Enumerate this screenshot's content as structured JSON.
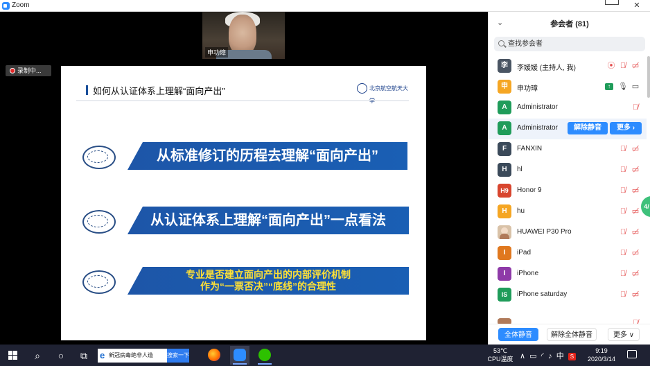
{
  "window": {
    "title": "Zoom"
  },
  "video": {
    "speaker_name": "申功璋",
    "recording_label": "录制中..."
  },
  "slide": {
    "title": "如何从认证体系上理解“面向产出”",
    "university": "北京航空航天大学",
    "bands": [
      {
        "text": "从标准修订的历程去理解“面向产出”"
      },
      {
        "text": "从认证体系上理解“面向产出”一点看法"
      },
      {
        "line1": "专业是否建立面向产出的内部评价机制",
        "line2": "作为“一票否决”“底线”的合理性"
      }
    ]
  },
  "participants_panel": {
    "title": "参会者 (81)",
    "search_placeholder": "查找参会者",
    "participants": [
      {
        "avatar": "李",
        "color": "#4a5563",
        "name": "李媛媛 (主持人, 我)"
      },
      {
        "avatar": "申",
        "color": "#f5a623",
        "name": "申功璋"
      },
      {
        "avatar": "A",
        "color": "#1f9c5a",
        "name": "Administrator"
      },
      {
        "avatar": "A",
        "color": "#1f9c5a",
        "name": "Administrator",
        "unmute_label": "解除静音",
        "more_label": "更多 ›"
      },
      {
        "avatar": "F",
        "color": "#3b4a5a",
        "name": "FANXIN"
      },
      {
        "avatar": "H",
        "color": "#3b4a5a",
        "name": "hl"
      },
      {
        "avatar": "H9",
        "color": "#d8452e",
        "name": "Honor 9"
      },
      {
        "avatar": "H",
        "color": "#f5a623",
        "name": "hu"
      },
      {
        "avatar": "",
        "color": "#d9c2a8",
        "name": "HUAWEI P30 Pro"
      },
      {
        "avatar": "I",
        "color": "#e0781f",
        "name": "iPad"
      },
      {
        "avatar": "I",
        "color": "#8e3aa8",
        "name": "iPhone"
      },
      {
        "avatar": "IS",
        "color": "#1f9c5a",
        "name": "iPhone saturday"
      }
    ],
    "footer": {
      "mute_all": "全体静音",
      "unmute_all": "解除全体静音",
      "more": "更多 ∨"
    },
    "side_tab": "4/"
  },
  "taskbar": {
    "search_query": "新冠病毒绝非人造",
    "search_button": "搜索一下",
    "temperature": "53℃",
    "temperature_label": "CPU温度",
    "ime": "中",
    "time": "9:19",
    "date": "2020/3/14"
  }
}
